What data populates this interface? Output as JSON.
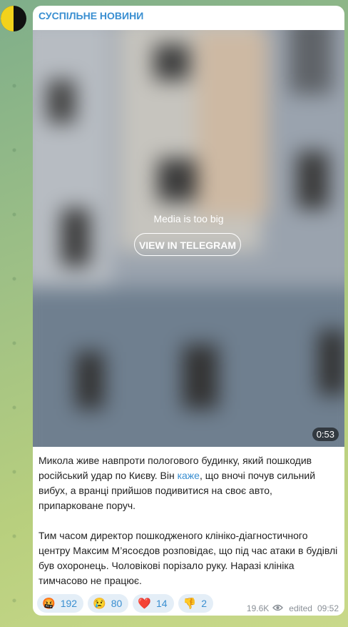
{
  "channel": {
    "name": "СУСПІЛЬНЕ НОВИНИ"
  },
  "media": {
    "notice": "Media is too big",
    "button_label": "VIEW IN TELEGRAM",
    "duration": "0:53"
  },
  "message": {
    "p1_before": "Микола живе навпроти пологового будинку, який пошкодив російський удар по Києву. Він ",
    "p1_link": "каже",
    "p1_after": ", що вночі почув сильний вибух, а вранці прийшов подивитися на своє авто, припарковане поруч.",
    "p2": "Тим часом директор пошкодженого клініко-діагностичного центру Максим М’ясоєдов розповідає, що під час атаки в будівлі був охоронець. Чоловікові порізало руку. Наразі клініка тимчасово не працює."
  },
  "reactions": [
    {
      "emoji": "🤬",
      "count": "192"
    },
    {
      "emoji": "😢",
      "count": "80"
    },
    {
      "emoji": "❤️",
      "count": "14"
    },
    {
      "emoji": "👎",
      "count": "2"
    }
  ],
  "meta": {
    "views": "19.6K",
    "edited": "edited",
    "time": "09:52"
  },
  "colors": {
    "accent": "#3a8fd1",
    "reaction_bg": "#e4eef7"
  }
}
